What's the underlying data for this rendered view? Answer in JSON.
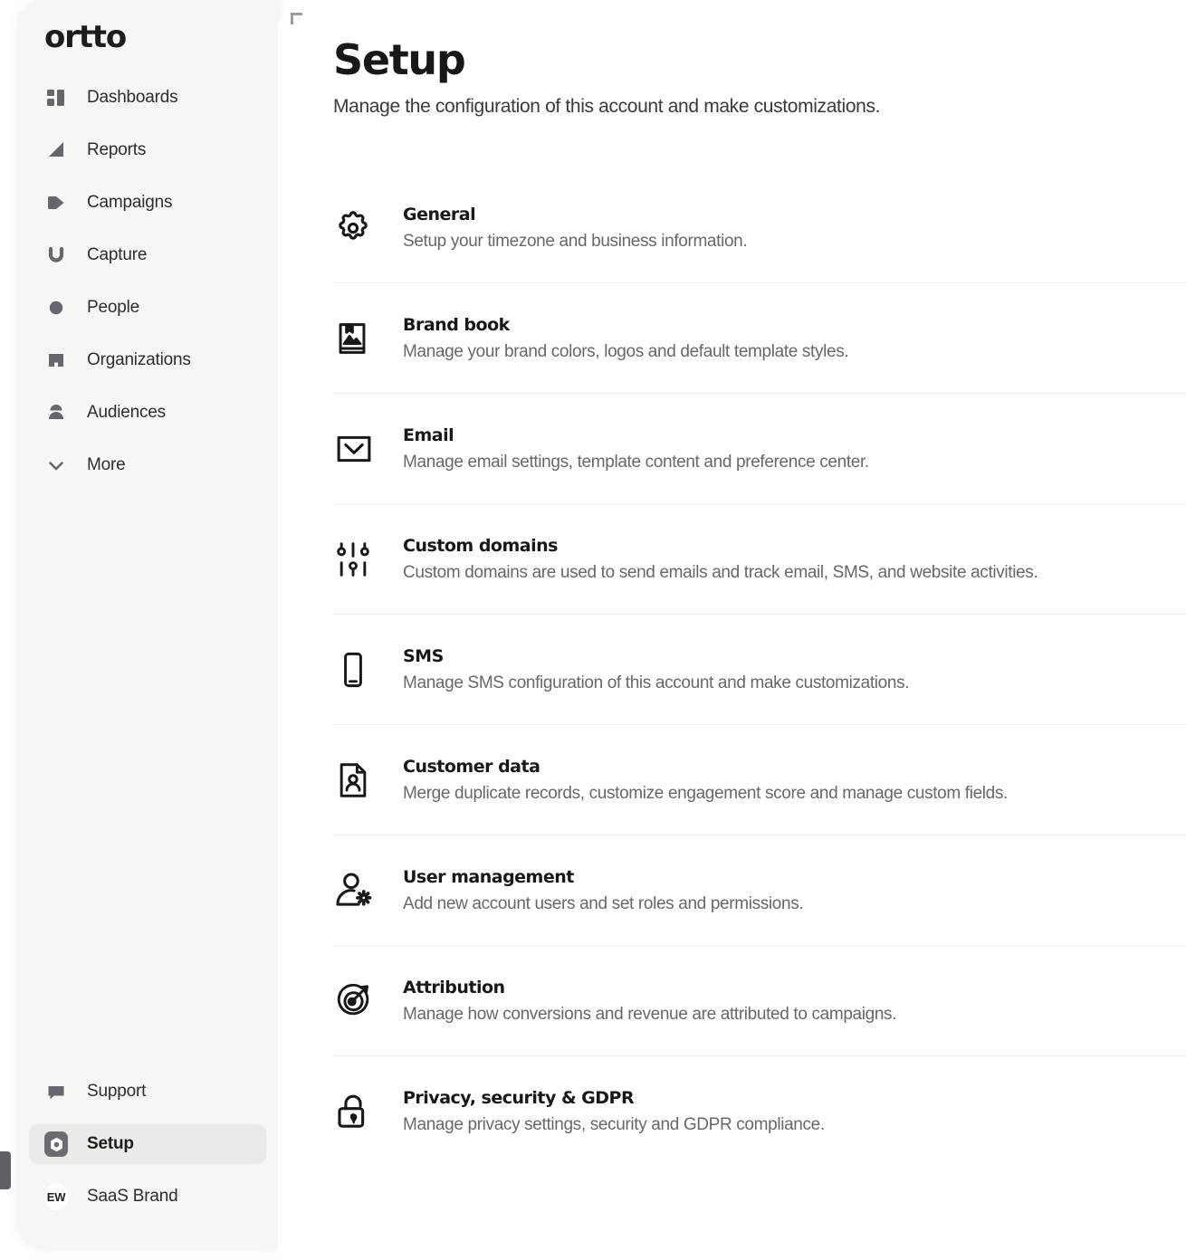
{
  "brand": {
    "logo_text": "ortto"
  },
  "sidebar": {
    "items": [
      {
        "label": "Dashboards",
        "icon": "dashboards-icon"
      },
      {
        "label": "Reports",
        "icon": "reports-icon"
      },
      {
        "label": "Campaigns",
        "icon": "campaigns-icon"
      },
      {
        "label": "Capture",
        "icon": "capture-icon"
      },
      {
        "label": "People",
        "icon": "people-icon"
      },
      {
        "label": "Organizations",
        "icon": "organizations-icon"
      },
      {
        "label": "Audiences",
        "icon": "audiences-icon"
      },
      {
        "label": "More",
        "icon": "chevron-down-icon"
      }
    ],
    "bottom_items": [
      {
        "label": "Support",
        "icon": "support-chat-icon",
        "active": false
      },
      {
        "label": "Setup",
        "icon": "setup-gear-icon",
        "active": true
      }
    ],
    "account": {
      "initials": "EW",
      "name": "SaaS Brand"
    }
  },
  "main": {
    "title": "Setup",
    "subtitle": "Manage the configuration of this account and make customizations.",
    "rows": [
      {
        "icon": "gear-icon",
        "title": "General",
        "desc": "Setup your timezone and business information."
      },
      {
        "icon": "brandbook-icon",
        "title": "Brand book",
        "desc": "Manage your brand colors, logos and default template styles."
      },
      {
        "icon": "envelope-icon",
        "title": "Email",
        "desc": "Manage email settings, template content and preference center."
      },
      {
        "icon": "sliders-icon",
        "title": "Custom domains",
        "desc": "Custom domains are used to send emails and track email, SMS, and website activities."
      },
      {
        "icon": "phone-icon",
        "title": "SMS",
        "desc": "Manage SMS configuration of this account and make customizations."
      },
      {
        "icon": "document-person-icon",
        "title": "Customer data",
        "desc": "Merge duplicate records, customize engagement score and manage custom fields."
      },
      {
        "icon": "person-gear-icon",
        "title": "User management",
        "desc": "Add new account users and set roles and permissions."
      },
      {
        "icon": "target-arrow-icon",
        "title": "Attribution",
        "desc": "Manage how conversions and revenue are attributed to campaigns."
      },
      {
        "icon": "unlocked-padlock-icon",
        "title": "Privacy, security & GDPR",
        "desc": "Manage privacy settings, security and GDPR compliance."
      }
    ]
  },
  "colors": {
    "sidebar_bg": "#f7f6f4",
    "active_item_bg": "#eceae7",
    "icon_grey": "#66666d",
    "text_dark": "#18181b",
    "text_muted": "#67676c",
    "divider": "#f0efee"
  }
}
